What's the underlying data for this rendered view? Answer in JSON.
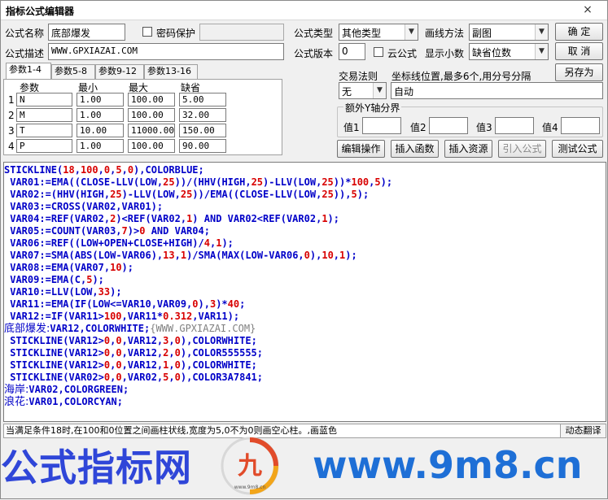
{
  "window": {
    "title": "指标公式编辑器",
    "close_icon": "×"
  },
  "header": {
    "name_label": "公式名称",
    "name_value": "底部爆发",
    "password_label": "密码保护",
    "desc_label": "公式描述",
    "desc_value": "WWW.GPXIAZAI.COM",
    "type_label": "公式类型",
    "type_value": "其他类型",
    "draw_label": "画线方法",
    "draw_value": "副图",
    "version_label": "公式版本",
    "version_value": "0",
    "cloud_label": "云公式",
    "decimals_label": "显示小数",
    "decimals_value": "缺省位数"
  },
  "buttons": {
    "ok": "确  定",
    "cancel": "取  消",
    "save_as": "另存为",
    "edit_ops": "编辑操作",
    "insert_func": "插入函数",
    "insert_res": "插入资源",
    "import_formula": "引入公式",
    "test_formula": "测试公式"
  },
  "tabs": [
    "参数1-4",
    "参数5-8",
    "参数9-12",
    "参数13-16"
  ],
  "params": {
    "headers": [
      "参数",
      "最小",
      "最大",
      "缺省"
    ],
    "rows": [
      {
        "idx": "1",
        "name": "N",
        "min": "1.00",
        "max": "100.00",
        "def": "5.00"
      },
      {
        "idx": "2",
        "name": "M",
        "min": "1.00",
        "max": "100.00",
        "def": "32.00"
      },
      {
        "idx": "3",
        "name": "T",
        "min": "10.00",
        "max": "11000.00",
        "def": "150.00"
      },
      {
        "idx": "4",
        "name": "P",
        "min": "1.00",
        "max": "100.00",
        "def": "90.00"
      }
    ]
  },
  "trade": {
    "rule_label": "交易法则",
    "rule_value": "无",
    "coord_label": "坐标线位置,最多6个,用分号分隔",
    "coord_value": "自动"
  },
  "yaxis": {
    "title": "额外Y轴分界",
    "labels": [
      "值1",
      "值2",
      "值3",
      "值4"
    ]
  },
  "code": [
    "STICKLINE(18,100,0,5,0),COLORBLUE;",
    " VAR01:=EMA((CLOSE-LLV(LOW,25))/(HHV(HIGH,25)-LLV(LOW,25))*100,5);",
    " VAR02:=(HHV(HIGH,25)-LLV(LOW,25))/EMA((CLOSE-LLV(LOW,25)),5);",
    " VAR03:=CROSS(VAR02,VAR01);",
    " VAR04:=REF(VAR02,2)<REF(VAR02,1) AND VAR02<REF(VAR02,1);",
    " VAR05:=COUNT(VAR03,7)>0 AND VAR04;",
    " VAR06:=REF((LOW+OPEN+CLOSE+HIGH)/4,1);",
    " VAR07:=SMA(ABS(LOW-VAR06),13,1)/SMA(MAX(LOW-VAR06,0),10,1);",
    " VAR08:=EMA(VAR07,10);",
    " VAR09:=EMA(C,5);",
    " VAR10:=LLV(LOW,33);",
    " VAR11:=EMA(IF(LOW<=VAR10,VAR09,0),3)*40;",
    " VAR12:=IF(VAR11>100,VAR11*0.312,VAR11);",
    "底部爆发:VAR12,COLORWHITE;{WWW.GPXIAZAI.COM}",
    " STICKLINE(VAR12>0,0,VAR12,3,0),COLORWHITE;",
    " STICKLINE(VAR12>0,0,VAR12,2,0),COLOR555555;",
    " STICKLINE(VAR12>0,0,VAR12,1,0),COLORWHITE;",
    " STICKLINE(VAR02>0,0,VAR02,5,0),COLOR3A7841;",
    "海岸:VAR02,COLORGREEN;",
    "浪花:VAR01,COLORCYAN;"
  ],
  "status": {
    "text": "当满足条件18时,在100和0位置之间画柱状线,宽度为5,0不为0则画空心柱。,画蓝色",
    "button": "动态翻译"
  },
  "watermark": {
    "left_text": "公式指标网",
    "right_text": "www.9m8.cn",
    "logo_char": "九",
    "logo_sub": "www.9m8.cn"
  },
  "colors": {
    "code_blue": "#0000c8",
    "code_red": "#d80000",
    "comment_gray": "#808080"
  }
}
